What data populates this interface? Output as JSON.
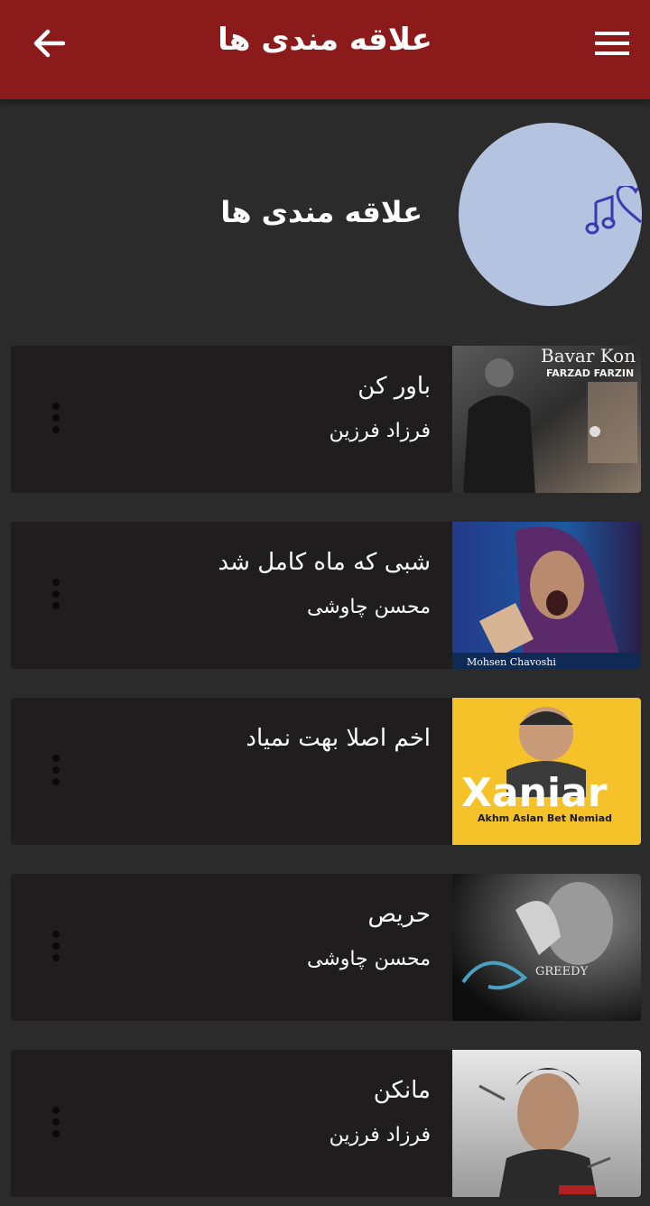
{
  "appbar": {
    "title": "علاقه مندی ها",
    "back_icon": "arrow-back-icon",
    "menu_icon": "hamburger-menu-icon",
    "color": "#8b1a1a"
  },
  "playlist": {
    "title": "علاقه مندی ها",
    "icon": "music-heart-icon",
    "avatar_color": "#b3c3e0",
    "icon_color": "#3a3ab0"
  },
  "songs": [
    {
      "title": "باور کن",
      "artist": "فرزاد فرزین",
      "cover_text": "Bavar Kon",
      "cover_subtext": "FARZAD FARZIN"
    },
    {
      "title": "شبی که ماه کامل شد",
      "artist": "محسن چاوشی",
      "cover_text": "Mohsen Chavoshi",
      "cover_subtext": ""
    },
    {
      "title": "اخم اصلا بهت نمیاد",
      "artist": "",
      "cover_text": "Xaniar",
      "cover_subtext": "Akhm Aslan Bet Nemiad"
    },
    {
      "title": "حریص",
      "artist": "محسن چاوشی",
      "cover_text": "GREEDY",
      "cover_subtext": ""
    },
    {
      "title": "مانکن",
      "artist": "فرزاد فرزین",
      "cover_text": "",
      "cover_subtext": ""
    }
  ],
  "more_icon": "more-vertical-icon"
}
